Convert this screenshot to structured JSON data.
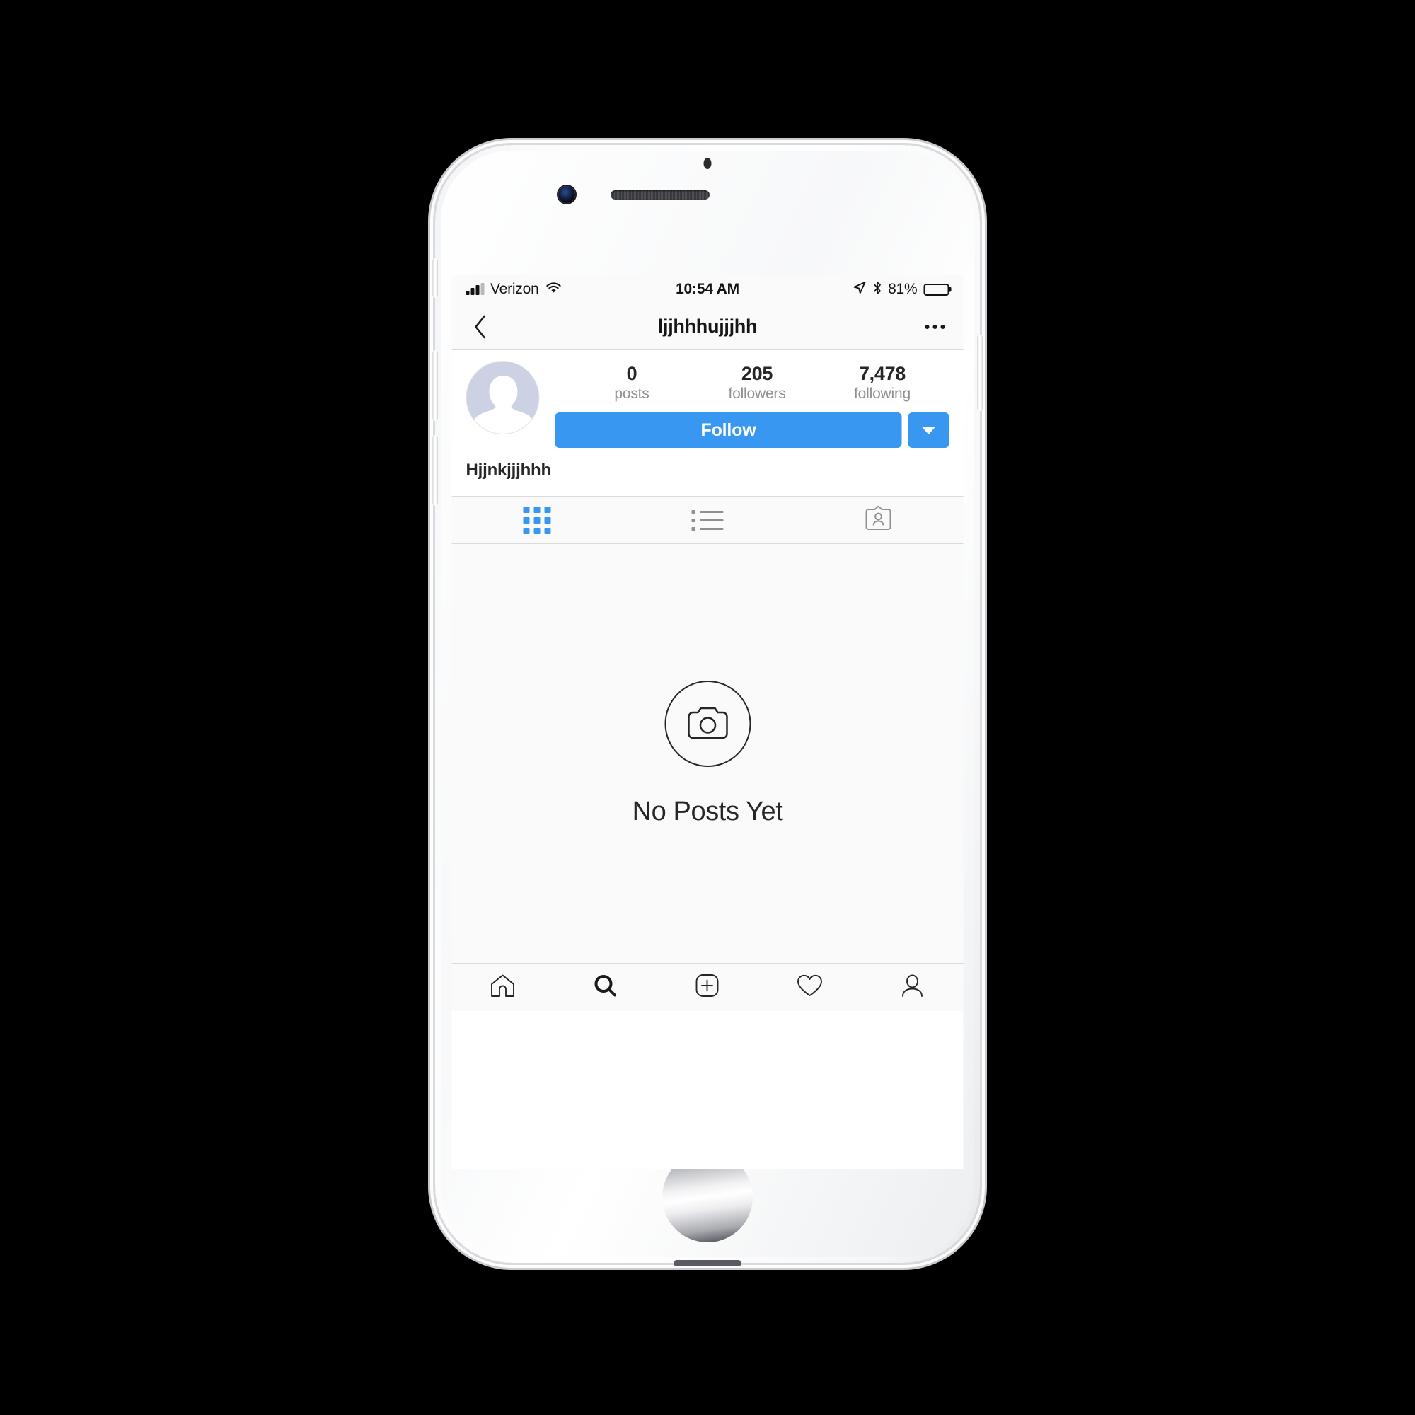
{
  "device": {
    "name": "iphone-white-silver",
    "hardware": {
      "mute_switch": "mute-switch",
      "volume_up": "volume-up-button",
      "volume_down": "volume-down-button",
      "power": "power-button",
      "home": "home-button",
      "front_camera": "front-camera",
      "earpiece": "earpiece-speaker",
      "proximity_sensor": "proximity-sensor"
    }
  },
  "status_bar": {
    "carrier": "Verizon",
    "signal_icon": "cellular-signal-icon",
    "wifi_icon": "wifi-icon",
    "time": "10:54 AM",
    "location_icon": "location-arrow-icon",
    "bluetooth_icon": "bluetooth-icon",
    "battery_percent": "81%",
    "battery_level": 81,
    "battery_icon": "battery-icon"
  },
  "nav_bar": {
    "back_icon": "chevron-left-icon",
    "title": "ljjhhhujjjhh",
    "more_icon": "more-horizontal-icon"
  },
  "profile": {
    "avatar_icon": "default-avatar-icon",
    "full_name": "Hjjnkjjjhhh",
    "stats": [
      {
        "value": "0",
        "label": "posts"
      },
      {
        "value": "205",
        "label": "followers"
      },
      {
        "value": "7,478",
        "label": "following"
      }
    ],
    "follow_label": "Follow",
    "dropdown_icon": "caret-down-icon"
  },
  "tabs": [
    {
      "name": "grid",
      "icon": "grid-icon",
      "active": true
    },
    {
      "name": "list",
      "icon": "list-icon",
      "active": false
    },
    {
      "name": "tagged",
      "icon": "tagged-id-card-icon",
      "active": false
    }
  ],
  "empty_state": {
    "icon": "camera-in-circle-icon",
    "title": "No Posts Yet"
  },
  "bottom_nav": [
    {
      "name": "home",
      "icon": "home-icon",
      "active": false
    },
    {
      "name": "search",
      "icon": "search-icon",
      "active": true
    },
    {
      "name": "add",
      "icon": "plus-square-icon",
      "active": false
    },
    {
      "name": "activity",
      "icon": "heart-icon",
      "active": false
    },
    {
      "name": "profile",
      "icon": "person-icon",
      "active": false
    }
  ],
  "colors": {
    "accent_blue": "#3897f0",
    "text_primary": "#262626",
    "text_secondary": "#8e8e93",
    "border": "#dbdbdb",
    "surface": "#fafafa"
  }
}
